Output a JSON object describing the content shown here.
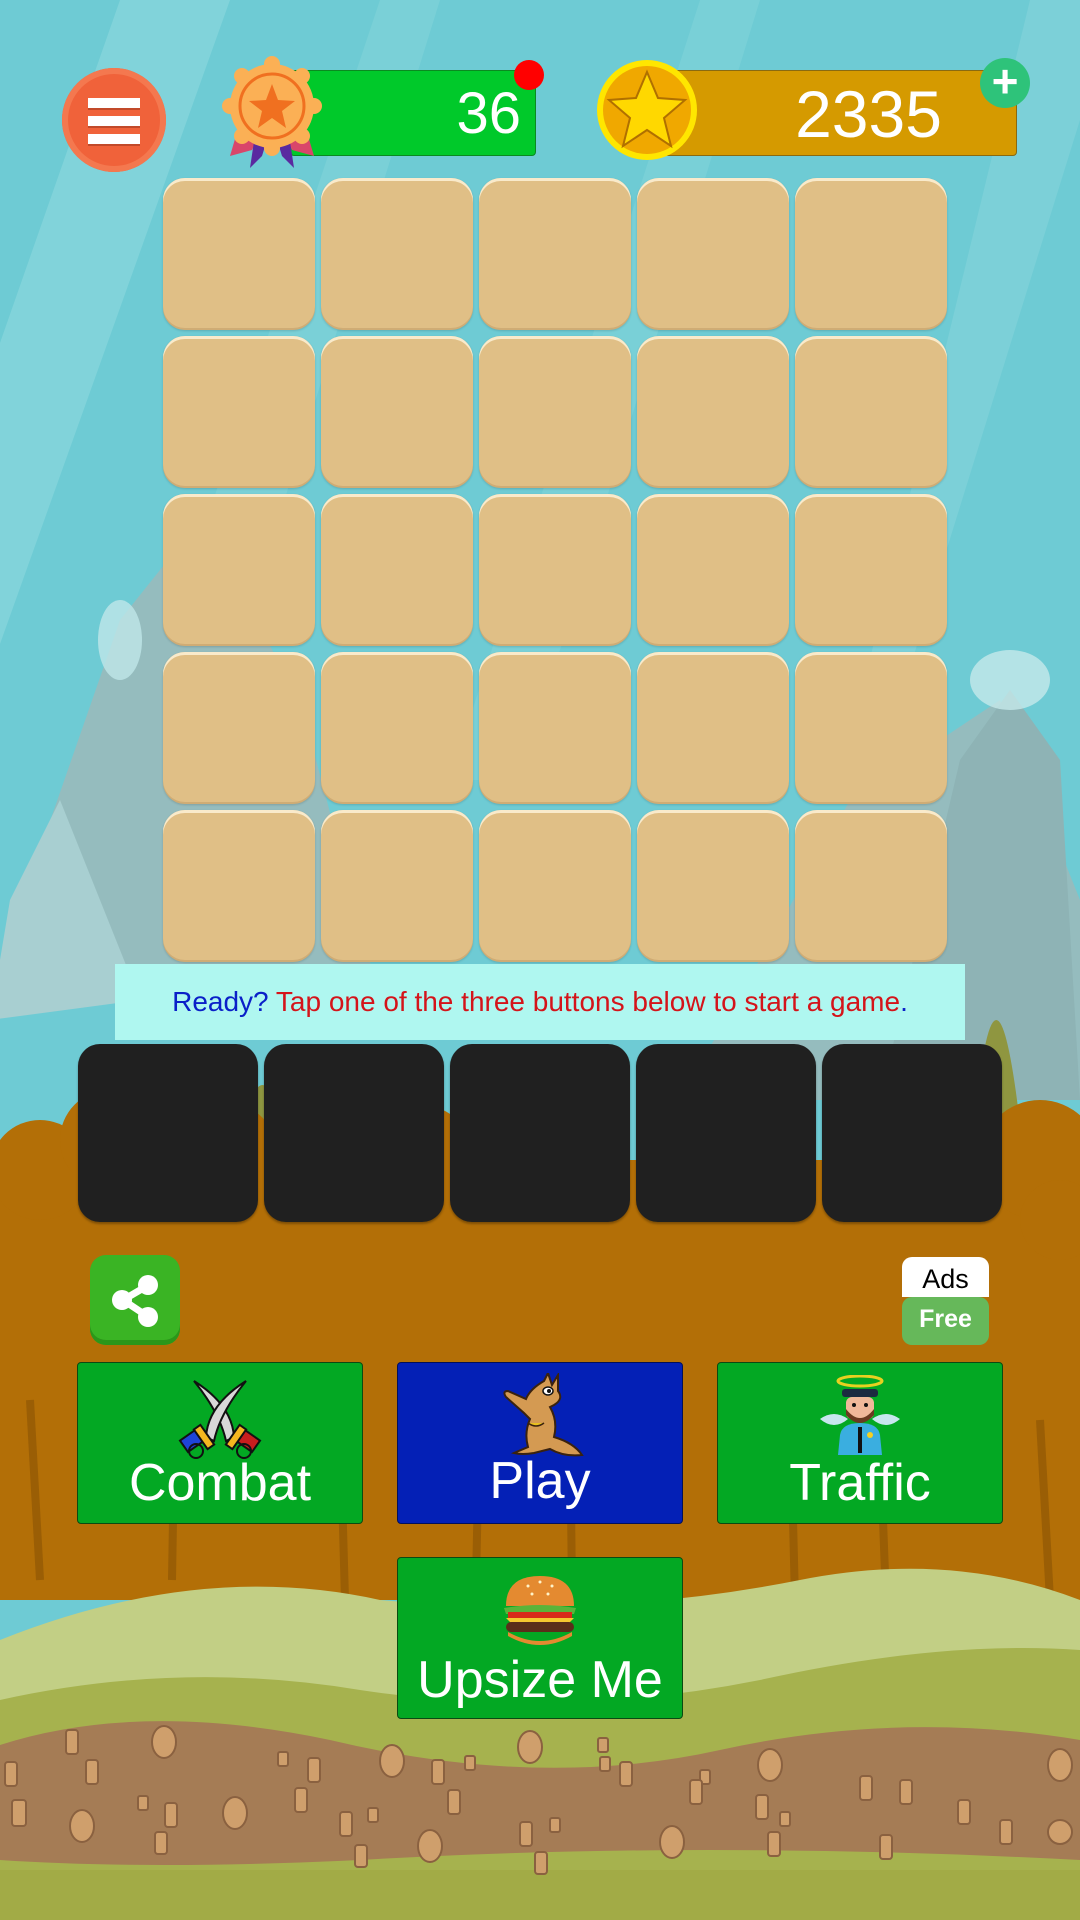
{
  "header": {
    "menu_icon": "hamburger-menu-icon",
    "medal": {
      "icon": "medal-icon",
      "value": "36",
      "has_notification": true
    },
    "coins": {
      "icon": "star-coin-icon",
      "value": "2335",
      "add_icon": "plus-icon"
    }
  },
  "board": {
    "rows": 5,
    "columns": 5,
    "tile_state": "face-down"
  },
  "message": {
    "prefix": "Ready?",
    "body": "Tap one of the three buttons below to start a game",
    "suffix": "."
  },
  "card_slots": {
    "count": 5,
    "state": "empty"
  },
  "share": {
    "icon": "share-icon"
  },
  "ads_free": {
    "line1": "Ads",
    "line2": "Free"
  },
  "modes": [
    {
      "label": "Combat",
      "icon": "crossed-swords-icon"
    },
    {
      "label": "Play",
      "icon": "kangaroo-icon"
    },
    {
      "label": "Traffic",
      "icon": "angel-police-icon"
    },
    {
      "label": "Upsize Me",
      "icon": "hamburger-food-icon"
    }
  ],
  "colors": {
    "menu": "#f0623a",
    "medal_bar": "#00c92a",
    "coin_bar": "#d59a00",
    "tile": "#e0bf86",
    "message_bg": "#aff7f0",
    "message_blue": "#0a20c8",
    "message_red": "#d4141a",
    "card": "#202020",
    "mode_green": "#03a823",
    "mode_blue": "#0420b6"
  }
}
